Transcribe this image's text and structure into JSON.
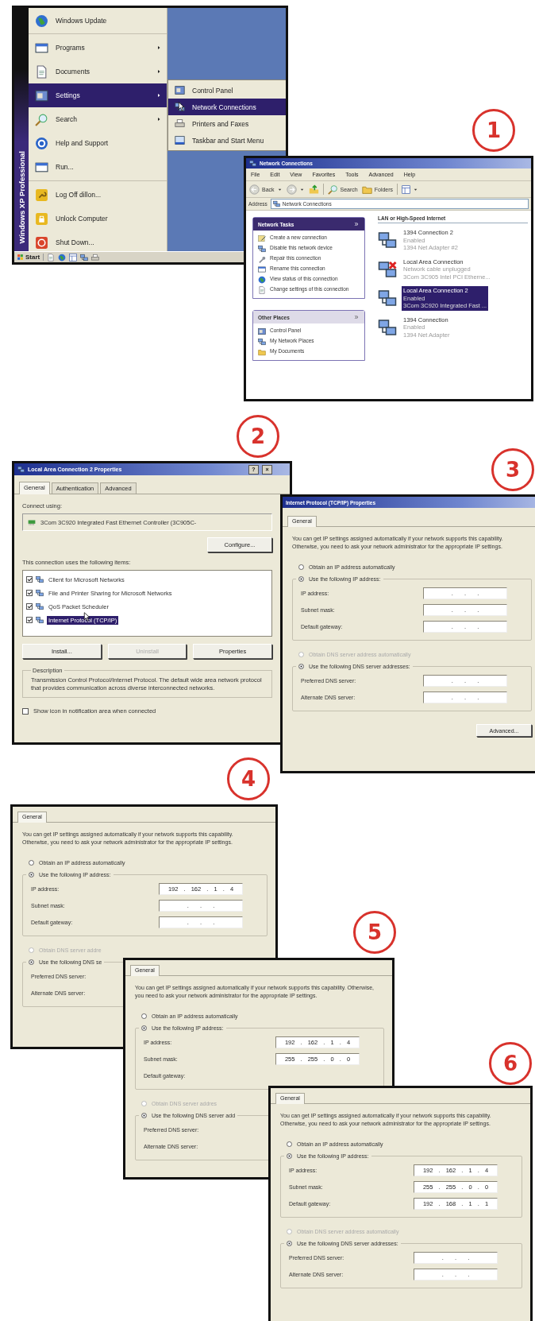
{
  "steps": [
    {
      "number": "1"
    },
    {
      "number": "2"
    },
    {
      "number": "3"
    },
    {
      "number": "4"
    },
    {
      "number": "5"
    },
    {
      "number": "6"
    }
  ],
  "start_menu": {
    "side_label": "Windows XP Professional",
    "sections": [
      {
        "items": [
          {
            "label": "Windows Update",
            "selected": false,
            "has_submenu": false
          }
        ]
      },
      {
        "items": [
          {
            "label": "Programs",
            "selected": false,
            "has_submenu": true
          },
          {
            "label": "Documents",
            "selected": false,
            "has_submenu": true
          },
          {
            "label": "Settings",
            "selected": true,
            "has_submenu": true
          },
          {
            "label": "Search",
            "selected": false,
            "has_submenu": true
          },
          {
            "label": "Help and Support",
            "selected": false,
            "has_submenu": false
          },
          {
            "label": "Run...",
            "selected": false,
            "has_submenu": false
          }
        ]
      },
      {
        "items": [
          {
            "label": "Log Off dillon...",
            "selected": false,
            "has_submenu": false
          },
          {
            "label": "Unlock Computer",
            "selected": false,
            "has_submenu": false
          },
          {
            "label": "Shut Down...",
            "selected": false,
            "has_submenu": false
          }
        ]
      }
    ],
    "submenu": [
      {
        "label": "Control Panel",
        "selected": false
      },
      {
        "label": "Network Connections",
        "selected": true
      },
      {
        "label": "Printers and Faxes",
        "selected": false
      },
      {
        "label": "Taskbar and Start Menu",
        "selected": false
      }
    ],
    "start_button": "Start"
  },
  "network_connections": {
    "title": "Network Connections",
    "menu": [
      "File",
      "Edit",
      "View",
      "Favorites",
      "Tools",
      "Advanced",
      "Help"
    ],
    "toolbar": {
      "back": "Back",
      "search": "Search",
      "folders": "Folders"
    },
    "address": {
      "label": "Address",
      "value": "Network Connections"
    },
    "task_panels": [
      {
        "title": "Network Tasks",
        "highlighted": true,
        "items": [
          "Create a new connection",
          "Disable this network device",
          "Repair this connection",
          "Rename this connection",
          "View status of this connection",
          "Change settings of this connection"
        ]
      },
      {
        "title": "Other Places",
        "highlighted": false,
        "items": [
          "Control Panel",
          "My Network Places",
          "My Documents"
        ]
      }
    ],
    "section_title": "LAN or High-Speed Internet",
    "connections": [
      {
        "name": "1394 Connection 2",
        "status": "Enabled",
        "device": "1394 Net Adapter #2",
        "selected": false,
        "disconnected": false
      },
      {
        "name": "Local Area Connection",
        "status": "Network cable unplugged",
        "device": "3Com 3C905 Intel PCI Etherne...",
        "selected": false,
        "disconnected": true
      },
      {
        "name": "Local Area Connection 2",
        "status": "Enabled",
        "device": "3Com 3C920 Integrated Fast ...",
        "selected": true,
        "disconnected": false
      },
      {
        "name": "1394 Connection",
        "status": "Enabled",
        "device": "1394 Net Adapter",
        "selected": false,
        "disconnected": false
      }
    ]
  },
  "connection_properties": {
    "title": "Local Area Connection 2 Properties",
    "title_buttons": [
      "?",
      "×"
    ],
    "tabs": [
      {
        "label": "General",
        "selected": true
      },
      {
        "label": "Authentication",
        "selected": false
      },
      {
        "label": "Advanced",
        "selected": false
      }
    ],
    "connect_using_label": "Connect using:",
    "adapter": "3Com 3C920 Integrated Fast Ethernet Controller (3C905C-",
    "configure_button": "Configure...",
    "items_label": "This connection uses the following items:",
    "items": [
      {
        "label": "Client for Microsoft Networks",
        "checked": true,
        "selected": false
      },
      {
        "label": "File and Printer Sharing for Microsoft Networks",
        "checked": true,
        "selected": false
      },
      {
        "label": "QoS Packet Scheduler",
        "checked": true,
        "selected": false
      },
      {
        "label": "Internet Protocol (TCP/IP)",
        "checked": true,
        "selected": true
      }
    ],
    "buttons": [
      {
        "label": "Install...",
        "disabled": false
      },
      {
        "label": "Uninstall",
        "disabled": true
      },
      {
        "label": "Properties",
        "disabled": false
      }
    ],
    "description_label": "Description",
    "description": "Transmission Control Protocol/Internet Protocol. The default wide area network protocol that provides communication across diverse interconnected networks.",
    "notify": {
      "label": "Show icon in notification area when connected",
      "checked": false
    }
  },
  "tcpip_dialogs": [
    {
      "title": "Internet Protocol (TCP/IP) Properties",
      "tabs": [
        {
          "label": "General",
          "selected": true
        }
      ],
      "intro": "You can get IP settings assigned automatically if your network supports this capability. Otherwise, you need to ask your network administrator for the appropriate IP settings.",
      "ip_auto": {
        "label": "Obtain an IP address automatically",
        "selected": false,
        "disabled": false
      },
      "ip_manual": {
        "label": "Use the following IP address:",
        "selected": true,
        "disabled": false,
        "rows": [
          {
            "label": "IP address:",
            "value": " .  .  . "
          },
          {
            "label": "Subnet mask:",
            "value": " .  .  . "
          },
          {
            "label": "Default gateway:",
            "value": " .  .  . "
          }
        ]
      },
      "dns_auto": {
        "label": "Obtain DNS server address automatically",
        "selected": false,
        "disabled": true
      },
      "dns_manual": {
        "label": "Use the following DNS server addresses:",
        "selected": true,
        "disabled": false,
        "rows": [
          {
            "label": "Preferred DNS server:",
            "value": " .  .  . "
          },
          {
            "label": "Alternate DNS server:",
            "value": " .  .  . "
          }
        ]
      },
      "buttons": [
        "Advanced..."
      ]
    },
    {
      "tabs": [
        {
          "label": "General",
          "selected": true
        }
      ],
      "intro": "You can get IP settings assigned automatically if your network supports this capability. Otherwise, you need to ask your network administrator for the appropriate IP settings.",
      "ip_auto": {
        "label": "Obtain an IP address automatically",
        "selected": false,
        "disabled": false
      },
      "ip_manual": {
        "label": "Use the following IP address:",
        "selected": true,
        "disabled": false,
        "rows": [
          {
            "label": "IP address:",
            "value": "192 . 162 . 1 . 4"
          },
          {
            "label": "Subnet mask:",
            "value": " .  .  . "
          },
          {
            "label": "Default gateway:",
            "value": " .  .  . "
          }
        ]
      },
      "dns_auto": {
        "label": "Obtain DNS server addre",
        "selected": false,
        "disabled": true
      },
      "dns_manual": {
        "label": "Use the following DNS se",
        "selected": true,
        "disabled": false,
        "rows": [
          {
            "label": "Preferred DNS server:"
          },
          {
            "label": "Alternate DNS server:"
          }
        ]
      }
    },
    {
      "tabs": [
        {
          "label": "General",
          "selected": true
        }
      ],
      "intro": "You can get IP settings assigned automatically if your network supports this capability. Otherwise, you need to ask your network administrator for the appropriate IP settings.",
      "ip_auto": {
        "label": "Obtain an IP address automatically",
        "selected": false,
        "disabled": false
      },
      "ip_manual": {
        "label": "Use the following IP address:",
        "selected": true,
        "disabled": false,
        "rows": [
          {
            "label": "IP address:",
            "value": "192 . 162 . 1 . 4"
          },
          {
            "label": "Subnet mask:",
            "value": "255 . 255 . 0 . 0"
          },
          {
            "label": "Default gateway:"
          }
        ]
      },
      "dns_auto": {
        "label": "Obtain DNS server addres",
        "selected": false,
        "disabled": true
      },
      "dns_manual": {
        "label": "Use the following DNS server add",
        "selected": true,
        "disabled": false,
        "rows": [
          {
            "label": "Preferred DNS server:"
          },
          {
            "label": "Alternate DNS server:"
          }
        ]
      }
    },
    {
      "tabs": [
        {
          "label": "General",
          "selected": true
        }
      ],
      "intro": "You can get IP settings assigned automatically if your network supports this capability. Otherwise, you need to ask your network administrator for the appropriate IP settings.",
      "ip_auto": {
        "label": "Obtain an IP address automatically",
        "selected": false,
        "disabled": false
      },
      "ip_manual": {
        "label": "Use the following IP address:",
        "selected": true,
        "disabled": false,
        "rows": [
          {
            "label": "IP address:",
            "value": "192 . 162 . 1 . 4"
          },
          {
            "label": "Subnet mask:",
            "value": "255 . 255 . 0 . 0"
          },
          {
            "label": "Default gateway:",
            "value": "192 . 168 . 1 . 1"
          }
        ]
      },
      "dns_auto": {
        "label": "Obtain DNS server address automatically",
        "selected": false,
        "disabled": true
      },
      "dns_manual": {
        "label": "Use the following DNS server addresses:",
        "selected": true,
        "disabled": false,
        "rows": [
          {
            "label": "Preferred DNS server:",
            "value": " .  .  . "
          },
          {
            "label": "Alternate DNS server:",
            "value": " .  .  . "
          }
        ]
      }
    }
  ]
}
